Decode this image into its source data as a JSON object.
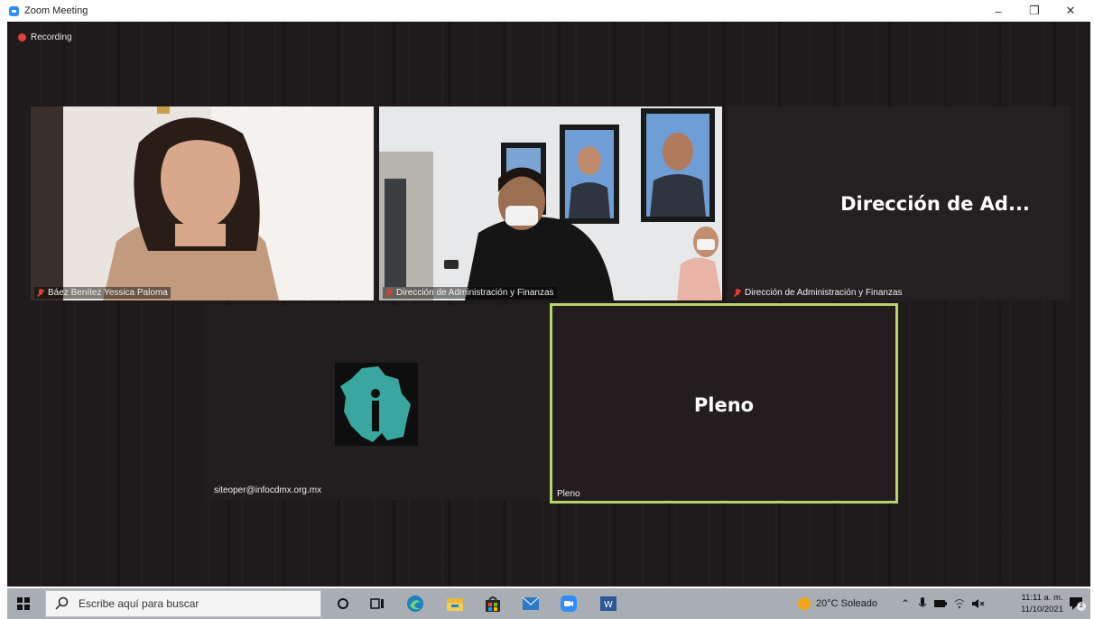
{
  "window": {
    "title": "Zoom Meeting",
    "minimize": "–",
    "restore": "❐",
    "close": "✕"
  },
  "meeting": {
    "recording_label": "Recording",
    "tiles": [
      {
        "name": "Báez Benítez Yessica Paloma"
      },
      {
        "name": "Dirección de Administración y Finanzas"
      },
      {
        "display": "Dirección de Ad...",
        "name": "Dirección de Administración y Finanzas"
      },
      {
        "name": "siteoper@infocdmx.org.mx"
      },
      {
        "display": "Pleno",
        "name": "Pleno"
      }
    ]
  },
  "taskbar": {
    "search_placeholder": "Escribe aquí para buscar",
    "apps": [
      "cortana-icon",
      "task-view-icon",
      "edge-icon",
      "file-explorer-icon",
      "store-icon",
      "mail-icon",
      "zoom-icon",
      "word-icon"
    ],
    "weather": "20°C  Soleado",
    "time": "11:11 a. m.",
    "date": "11/10/2021",
    "notifications": "2"
  },
  "colors": {
    "accent_active_speaker": "#b9d36b",
    "recording": "#e0403a",
    "info_logo": "#3aa6a0"
  }
}
